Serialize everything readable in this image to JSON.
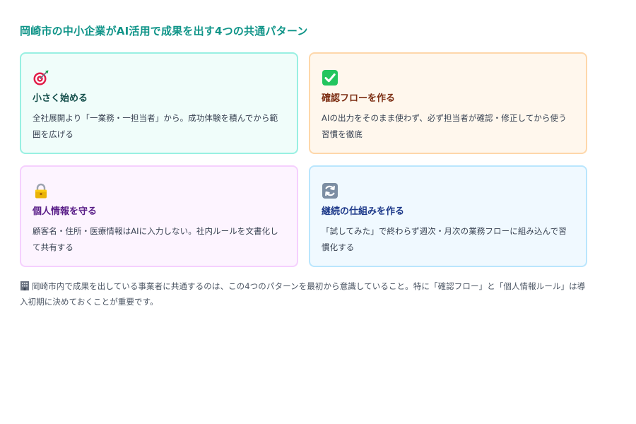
{
  "page": {
    "title": "岡崎市の中小企業がAI活用で成果を出す4つの共通パターン"
  },
  "cards": [
    {
      "icon": "target-icon",
      "title": "小さく始める",
      "text": "全社展開より「一業務・一担当者」から。成功体験を積んでから範囲を広げる"
    },
    {
      "icon": "check-mark-icon",
      "title": "確認フローを作る",
      "text": "AIの出力をそのまま使わず、必ず担当者が確認・修正してから使う習慣を徹底"
    },
    {
      "icon": "lock-icon",
      "title": "個人情報を守る",
      "text": "顧客名・住所・医療情報はAIに入力しない。社内ルールを文書化して共有する"
    },
    {
      "icon": "refresh-icon",
      "title": "継続の仕組みを作る",
      "text": "「試してみた」で終わらず週次・月次の業務フローに組み込んで習慣化する"
    }
  ],
  "note": {
    "icon": "building-icon",
    "text": "岡崎市内で成果を出している事業者に共通するのは、この4つのパターンを最初から意識していること。特に「確認フロー」と「個人情報ルール」は導入初期に決めておくことが重要です。"
  },
  "colors": {
    "title": "#0f9488",
    "card_backgrounds": [
      "#f0fdfa",
      "#fff7ed",
      "#fdf4ff",
      "#f0f9ff"
    ],
    "card_borders": [
      "#99f0e2",
      "#fed7aa",
      "#f5d0fe",
      "#bae6fd"
    ]
  }
}
